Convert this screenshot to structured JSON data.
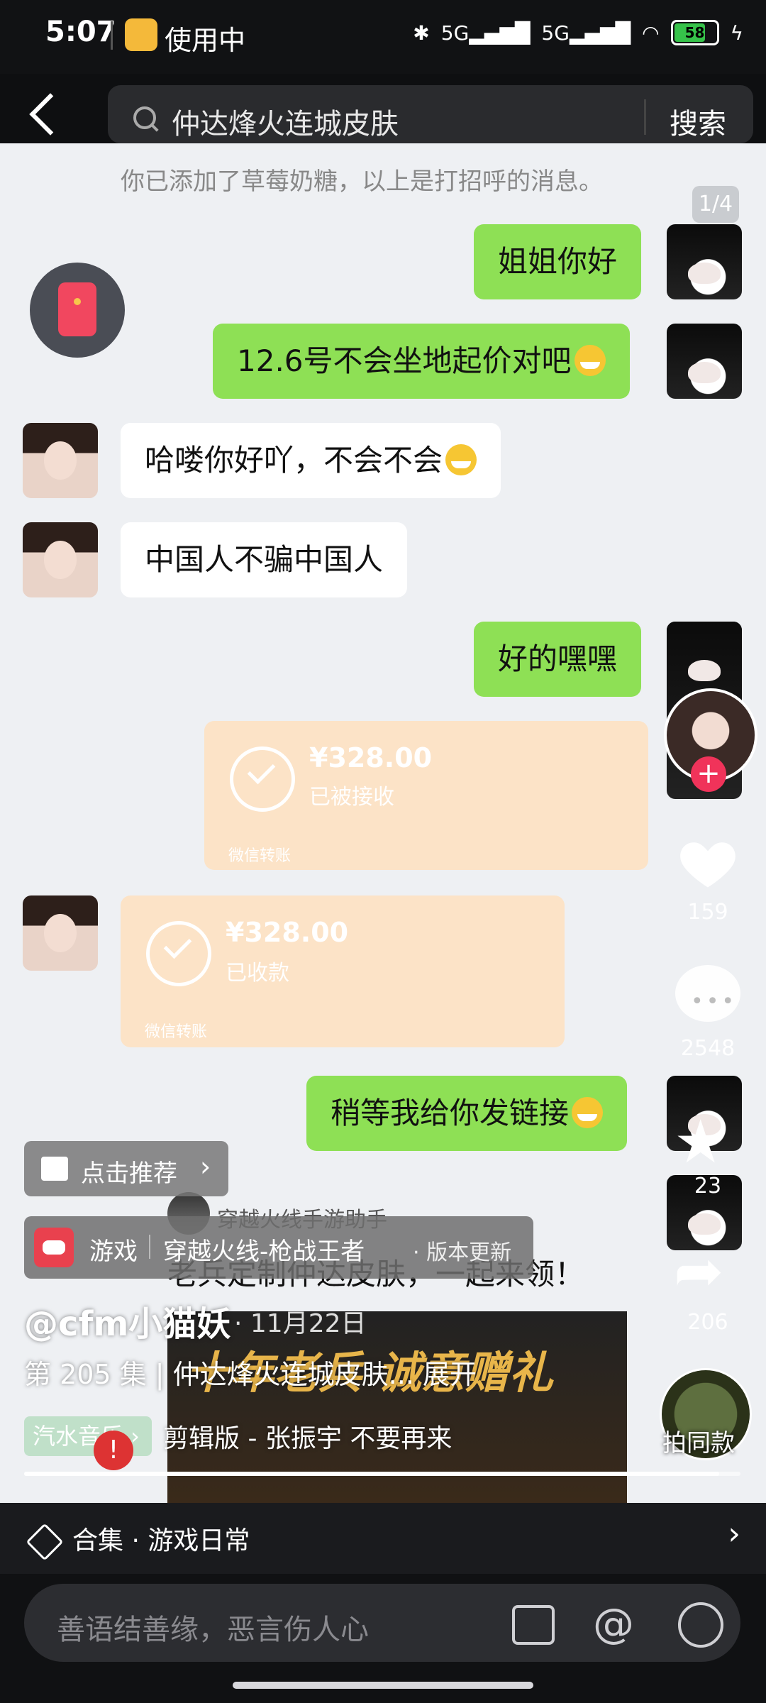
{
  "status": {
    "time": "5:07",
    "app": "使用中",
    "battery": "58"
  },
  "search": {
    "query": "仲达烽火连城皮肤",
    "button": "搜索"
  },
  "chat": {
    "system_msg": "你已添加了草莓奶糖，以上是打招呼的消息。",
    "counter": "1/4",
    "msg1": "姐姐你好",
    "msg2": "12.6号不会坐地起价对吧",
    "msg3": "哈喽你好吖，不会不会",
    "msg4": "中国人不骗中国人",
    "msg5": "好的嘿嘿",
    "transfer1": {
      "amount": "¥328.00",
      "status": "已被接收",
      "source": "微信转账"
    },
    "transfer2": {
      "amount": "¥328.00",
      "status": "已收款",
      "source": "微信转账"
    },
    "msg6": "稍等我给你发链接"
  },
  "actions": {
    "likes": "159",
    "comments": "2548",
    "favorites": "23",
    "shares": "206",
    "same": "拍同款"
  },
  "overlay": {
    "recommend": "点击推荐",
    "game_label": "游戏",
    "game_name": "穿越火线-枪战王者",
    "game_update": "· 版本更新",
    "preview_user": "穿越火线手游助手",
    "preview_title": "老兵定制仲达皮肤，一起来领！",
    "preview_banner": "十年老兵 诚意赠礼",
    "author": "@cfm小猫妖",
    "date": "· 11月22日",
    "episode": "第 205 集 | 仲达烽火连城皮肤... 展开",
    "music_tag": "汽水音乐 ›",
    "music_name": "剪辑版 - 张振宇    不要再来",
    "notif": "!",
    "progress": 0.97
  },
  "collection": {
    "label": "合集 · 游戏日常"
  },
  "comment": {
    "placeholder": "善语结善缘，恶言伤人心"
  }
}
